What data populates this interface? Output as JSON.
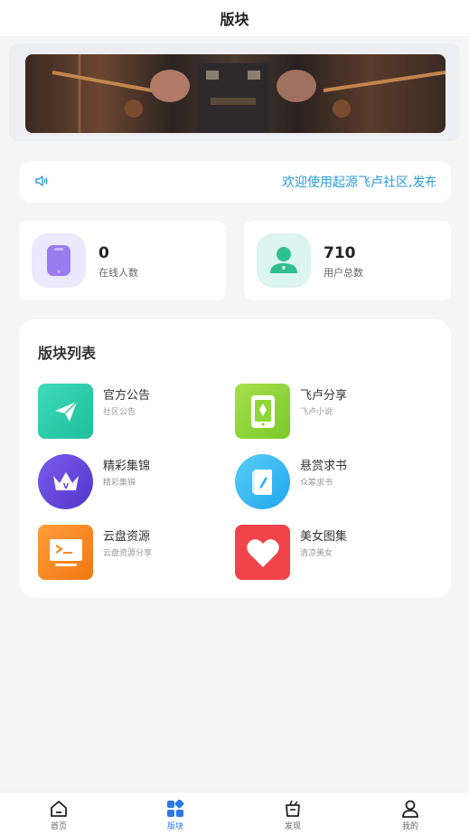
{
  "header": {
    "title": "版块"
  },
  "notice": {
    "text": "欢迎使用起源飞卢社区,发布"
  },
  "stats": [
    {
      "value": "0",
      "label": "在线人数",
      "icon": "phone-icon"
    },
    {
      "value": "710",
      "label": "用户总数",
      "icon": "user-icon"
    }
  ],
  "board": {
    "title": "版块列表",
    "items": [
      {
        "name": "官方公告",
        "desc": "社区公告",
        "icon": "paper-plane-icon",
        "color": "#2ecfae"
      },
      {
        "name": "飞卢分享",
        "desc": "飞卢小说",
        "icon": "tablet-icon",
        "color": "#8fd63a"
      },
      {
        "name": "精彩集锦",
        "desc": "精彩集锦",
        "icon": "crown-icon",
        "color": "#6c4fe0"
      },
      {
        "name": "悬赏求书",
        "desc": "众筹求书",
        "icon": "book-icon",
        "color": "#31b6f2"
      },
      {
        "name": "云盘资源",
        "desc": "云盘资源分享",
        "icon": "terminal-icon",
        "color": "#f58a22"
      },
      {
        "name": "美女图集",
        "desc": "清凉美女",
        "icon": "heart-icon",
        "color": "#f0444a"
      }
    ]
  },
  "tabbar": {
    "tabs": [
      {
        "label": "首页",
        "icon": "home-icon"
      },
      {
        "label": "版块",
        "icon": "grid-icon",
        "active": true
      },
      {
        "label": "发现",
        "icon": "discover-icon"
      },
      {
        "label": "我的",
        "icon": "profile-icon"
      }
    ]
  },
  "colors": {
    "accent": "#2b7ae6",
    "notice": "#2a9bd9",
    "background": "#f5f5f5"
  }
}
